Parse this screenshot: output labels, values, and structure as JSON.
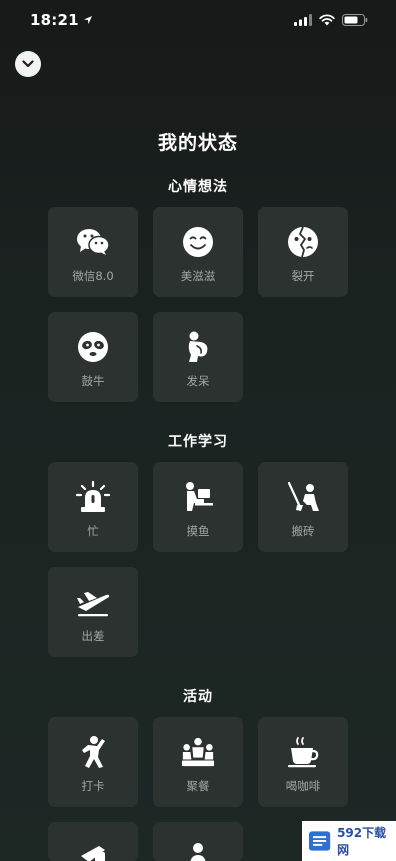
{
  "status_bar": {
    "time": "18:21"
  },
  "page": {
    "title": "我的状态"
  },
  "sections": [
    {
      "title": "心情想法",
      "items": [
        {
          "label": "微信8.0",
          "icon": "wechat-icon"
        },
        {
          "label": "美滋滋",
          "icon": "smile-icon"
        },
        {
          "label": "裂开",
          "icon": "cracked-face-icon"
        },
        {
          "label": "鼓牛",
          "icon": "panda-face-icon"
        },
        {
          "label": "发呆",
          "icon": "dazed-figure-icon"
        }
      ]
    },
    {
      "title": "工作学习",
      "items": [
        {
          "label": "忙",
          "icon": "alarm-light-icon"
        },
        {
          "label": "摸鱼",
          "icon": "desk-person-icon"
        },
        {
          "label": "搬砖",
          "icon": "shovel-person-icon"
        },
        {
          "label": "出差",
          "icon": "airplane-icon"
        }
      ]
    },
    {
      "title": "活动",
      "items": [
        {
          "label": "打卡",
          "icon": "runner-icon"
        },
        {
          "label": "聚餐",
          "icon": "group-dining-icon"
        },
        {
          "label": "喝咖啡",
          "icon": "coffee-cup-icon"
        }
      ]
    }
  ],
  "watermark": {
    "text": "592下载网"
  },
  "colors": {
    "tile": "#2c3230",
    "label": "#a3a7a5",
    "background": "#1b2321"
  }
}
